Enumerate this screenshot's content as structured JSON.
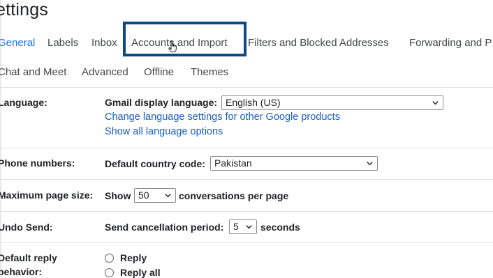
{
  "header": {
    "title": "ettings"
  },
  "tabs": {
    "row1": [
      {
        "label": "General",
        "active": true
      },
      {
        "label": "Labels",
        "active": false
      },
      {
        "label": "Inbox",
        "active": false
      },
      {
        "label": "Accounts and Import",
        "active": false,
        "highlighted": true
      },
      {
        "label": "Filters and Blocked Addresses",
        "active": false
      },
      {
        "label": "Forwarding and P",
        "active": false
      }
    ],
    "row2": [
      {
        "label": "Chat and Meet"
      },
      {
        "label": "Advanced"
      },
      {
        "label": "Offline"
      },
      {
        "label": "Themes"
      }
    ]
  },
  "settings": {
    "language": {
      "label": "Language:",
      "display_label": "Gmail display language:",
      "selected": "English (US)",
      "link_change": "Change language settings for other Google products",
      "link_show_all": "Show all language options"
    },
    "phone": {
      "label": "Phone numbers:",
      "country_label": "Default country code:",
      "selected": "Pakistan"
    },
    "page_size": {
      "label": "Maximum page size:",
      "prefix": "Show",
      "selected": "50",
      "suffix": "conversations per page"
    },
    "undo_send": {
      "label": "Undo Send:",
      "period_label": "Send cancellation period:",
      "selected": "5",
      "suffix": "seconds"
    },
    "default_reply": {
      "label_line1": "Default reply",
      "label_line2": "behavior:",
      "options": [
        "Reply",
        "Reply all"
      ]
    }
  },
  "colors": {
    "accent": "#1a73e8",
    "link": "#1a5fc4",
    "highlight_box": "#0b4a86",
    "divider": "#e0e0e0",
    "text": "#202124"
  },
  "icons": {
    "cursor": "hand-pointer-icon",
    "select_arrow": "chevron-down-icon"
  }
}
